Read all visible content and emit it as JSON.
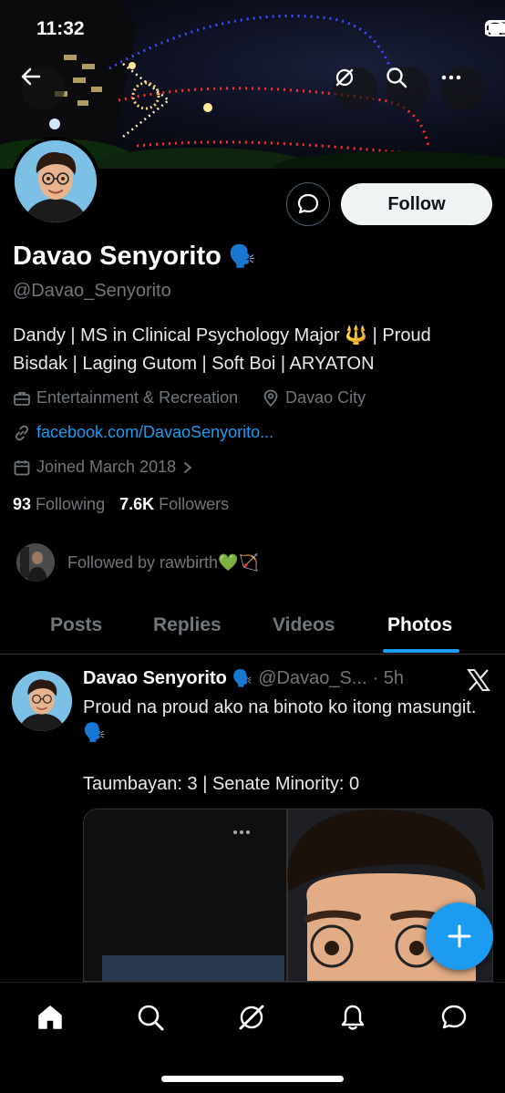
{
  "status_bar": {
    "time": "11:32"
  },
  "header": {
    "back_icon": "arrow-left-icon",
    "grok_icon": "grok-icon",
    "search_icon": "search-icon",
    "more_icon": "more-icon"
  },
  "profile": {
    "name": "Davao Senyorito",
    "name_emoji": "🗣️",
    "handle": "@Davao_Senyorito",
    "bio": "Dandy | MS in Clinical Psychology Major 🔱 | Proud Bisdak | Laging Gutom | Soft Boi | ARYATON",
    "category": "Entertainment & Recreation",
    "location": "Davao City",
    "website": "facebook.com/DavaoSenyorito...",
    "joined": "Joined March 2018",
    "following_count": "93",
    "following_label": "Following",
    "followers_count": "7.6K",
    "followers_label": "Followers",
    "followed_by": "Followed by rawbirth💚🏹",
    "follow_label": "Follow"
  },
  "tabs": [
    {
      "label": "Posts"
    },
    {
      "label": "Replies"
    },
    {
      "label": "Videos"
    },
    {
      "label": "Photos",
      "active": true
    }
  ],
  "post": {
    "name": "Davao Senyorito",
    "emoji": "🗣️",
    "handle": "@Davao_S...",
    "time": "· 5h",
    "line1": "Proud na proud ako na binoto ko itong masungit. 🗣️",
    "line2": "Taumbayan: 3 | Senate Minority: 0"
  },
  "colors": {
    "accent": "#1d9bf0",
    "background": "#000000",
    "muted": "#71767b"
  }
}
